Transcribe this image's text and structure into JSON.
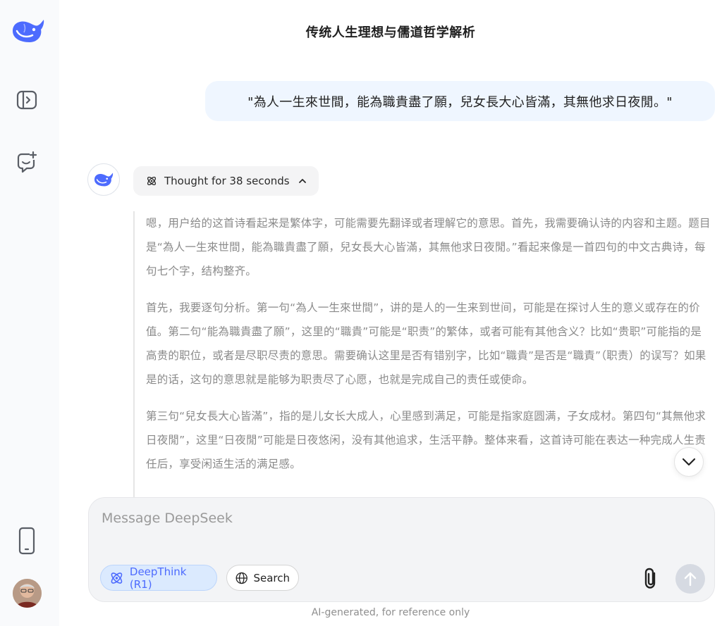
{
  "chat": {
    "title": "传统人生理想与儒道哲学解析"
  },
  "user_message": "\"為人一生來世間，能為職貴盡了願，兒女長大心皆滿，其無他求日夜閒。\"",
  "assistant": {
    "thought_label": "Thought for 38 seconds",
    "thinking_paragraphs": [
      "嗯，用户给的这首诗看起来是繁体字，可能需要先翻译或者理解它的意思。首先，我需要确认诗的内容和主题。题目是“為人一生來世間，能為職貴盡了願，兒女長大心皆滿，其無他求日夜閒。”看起来像是一首四句的中文古典诗，每句七个字，结构整齐。",
      "首先，我要逐句分析。第一句“為人一生來世間”，讲的是人的一生来到世间，可能是在探讨人生的意义或存在的价值。第二句“能為職貴盡了願”，这里的“職貴”可能是“职责”的繁体，或者可能有其他含义？比如“贵职”可能指的是高贵的职位，或者是尽职尽责的意思。需要确认这里是否有错别字，比如“職貴”是否是“職責”（职责）的误写？如果是的话，这句的意思就是能够为职责尽了心愿，也就是完成自己的责任或使命。",
      "第三句“兒女長大心皆滿”，指的是儿女长大成人，心里感到满足，可能是指家庭圆满，子女成材。第四句“其無他求日夜閒”，这里“日夜閒”可能是日夜悠闲，没有其他追求，生活平静。整体来看，这首诗可能在表达一种完成人生责任后，享受闲适生活的满足感。"
    ]
  },
  "composer": {
    "placeholder": "Message DeepSeek",
    "deepthink_label": "DeepThink (R1)",
    "search_label": "Search"
  },
  "footer": {
    "note": "AI-generated, for reference only"
  },
  "colors": {
    "accent": "#4d6bfe",
    "user_bubble": "#eff6ff",
    "sidebar_bg": "#f9fafc"
  }
}
